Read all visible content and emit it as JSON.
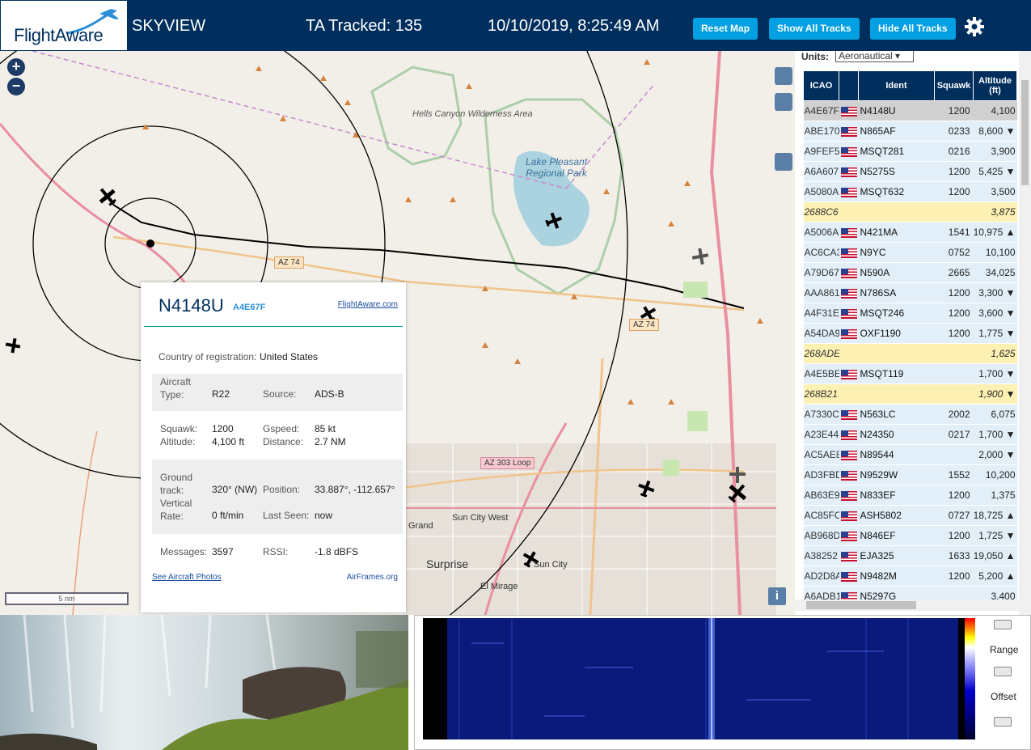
{
  "header": {
    "logo_text": "FlightAware",
    "app_name": "SKYVIEW",
    "tracked": "TA Tracked: 135",
    "datetime": "10/10/2019, 8:25:49 AM",
    "reset_label": "Reset Map",
    "show_label": "Show All Tracks",
    "hide_label": "Hide All Tracks"
  },
  "map": {
    "labels": {
      "hells_canyon": "Hells Canyon Wilderness Area",
      "lake_pleasant": "Lake Pleasant Regional Park",
      "az74_a": "AZ 74",
      "az74_b": "AZ 74",
      "az303": "AZ 303 Loop",
      "sun_city_west": "Sun City West",
      "surprise": "Surprise",
      "sun_city": "Sun City",
      "el_mirage": "El Mirage",
      "grand": "Grand"
    },
    "scale_label": "5 nm"
  },
  "popup": {
    "ident": "N4148U",
    "icao": "A4E67F",
    "link": "FlightAware.com",
    "country_label": "Country of registration:",
    "country": "United States",
    "aircraft_type_label": "Aircraft Type:",
    "aircraft_type": "R22",
    "source_label": "Source:",
    "source": "ADS-B",
    "squawk_label": "Squawk:",
    "squawk": "1200",
    "gspeed_label": "Gspeed:",
    "gspeed": "85 kt",
    "altitude_label": "Altitude:",
    "altitude": "4,100 ft",
    "distance_label": "Distance:",
    "distance": "2.7 NM",
    "track_label": "Ground track:",
    "track": "320° (NW)",
    "position_label": "Position:",
    "position": "33.887°, -112.657°",
    "vrate_label": "Vertical Rate:",
    "vrate": "0 ft/min",
    "lastseen_label": "Last Seen:",
    "lastseen": "now",
    "messages_label": "Messages:",
    "messages": "3597",
    "rssi_label": "RSSI:",
    "rssi": "-1.8 dBFS",
    "photos_link": "See Aircraft Photos",
    "airframes_link": "AirFrames.org"
  },
  "panel": {
    "units_label": "Units:",
    "units_value": "Aeronautical",
    "columns": [
      "ICAO",
      "",
      "Ident",
      "Squawk",
      "Altitude (ft)"
    ],
    "rows": [
      {
        "icao": "A4E67F",
        "flag": true,
        "ident": "N4148U",
        "squawk": "1200",
        "alt": "4,100",
        "kind": "sel"
      },
      {
        "icao": "ABE170",
        "flag": true,
        "ident": "N865AF",
        "squawk": "0233",
        "alt": "8,600 ▼",
        "kind": ""
      },
      {
        "icao": "A9FEF5",
        "flag": true,
        "ident": "MSQT281",
        "squawk": "0216",
        "alt": "3,900",
        "kind": ""
      },
      {
        "icao": "A6A607",
        "flag": true,
        "ident": "N5275S",
        "squawk": "1200",
        "alt": "5,425 ▼",
        "kind": ""
      },
      {
        "icao": "A5080A",
        "flag": true,
        "ident": "MSQT632",
        "squawk": "1200",
        "alt": "3,500",
        "kind": ""
      },
      {
        "icao": "2688C6",
        "flag": false,
        "ident": "",
        "squawk": "",
        "alt": "3,875",
        "kind": "mlat"
      },
      {
        "icao": "A5006A",
        "flag": true,
        "ident": "N421MA",
        "squawk": "1541",
        "alt": "10,975 ▲",
        "kind": ""
      },
      {
        "icao": "AC6CA3",
        "flag": true,
        "ident": "N9YC",
        "squawk": "0752",
        "alt": "10,100",
        "kind": ""
      },
      {
        "icao": "A79D67",
        "flag": true,
        "ident": "N590A",
        "squawk": "2665",
        "alt": "34,025",
        "kind": ""
      },
      {
        "icao": "AAA861",
        "flag": true,
        "ident": "N786SA",
        "squawk": "1200",
        "alt": "3,300 ▼",
        "kind": ""
      },
      {
        "icao": "A4F31E",
        "flag": true,
        "ident": "MSQT246",
        "squawk": "1200",
        "alt": "3,600 ▼",
        "kind": ""
      },
      {
        "icao": "A54DA9",
        "flag": true,
        "ident": "OXF1190",
        "squawk": "1200",
        "alt": "1,775 ▼",
        "kind": ""
      },
      {
        "icao": "268ADE",
        "flag": false,
        "ident": "",
        "squawk": "",
        "alt": "1,625",
        "kind": "mlat"
      },
      {
        "icao": "A4E5BE",
        "flag": true,
        "ident": "MSQT119",
        "squawk": "",
        "alt": "1,700 ▼",
        "kind": ""
      },
      {
        "icao": "268B21",
        "flag": false,
        "ident": "",
        "squawk": "",
        "alt": "1,900 ▼",
        "kind": "mlat"
      },
      {
        "icao": "A7330C",
        "flag": true,
        "ident": "N563LC",
        "squawk": "2002",
        "alt": "6,075",
        "kind": ""
      },
      {
        "icao": "A23E44",
        "flag": true,
        "ident": "N24350",
        "squawk": "0217",
        "alt": "1,700 ▼",
        "kind": ""
      },
      {
        "icao": "AC5AE8",
        "flag": true,
        "ident": "N89544",
        "squawk": "",
        "alt": "2,000 ▼",
        "kind": ""
      },
      {
        "icao": "AD3FBD",
        "flag": true,
        "ident": "N9529W",
        "squawk": "1552",
        "alt": "10,200",
        "kind": ""
      },
      {
        "icao": "AB63E9",
        "flag": true,
        "ident": "N833EF",
        "squawk": "1200",
        "alt": "1,375",
        "kind": ""
      },
      {
        "icao": "AC85FC",
        "flag": true,
        "ident": "ASH5802",
        "squawk": "0727",
        "alt": "18,725 ▲",
        "kind": ""
      },
      {
        "icao": "AB968D",
        "flag": true,
        "ident": "N846EF",
        "squawk": "1200",
        "alt": "1,725 ▼",
        "kind": ""
      },
      {
        "icao": "A38252",
        "flag": true,
        "ident": "EJA325",
        "squawk": "1633",
        "alt": "19,050 ▲",
        "kind": ""
      },
      {
        "icao": "AD2D8A",
        "flag": true,
        "ident": "N9482M",
        "squawk": "1200",
        "alt": "5,200 ▲",
        "kind": ""
      },
      {
        "icao": "A6ADB1",
        "flag": true,
        "ident": "N5297G",
        "squawk": "",
        "alt": "3,400",
        "kind": ""
      }
    ]
  },
  "spectrogram": {
    "range_label": "Range",
    "offset_label": "Offset"
  },
  "colors": {
    "header_bg": "#002f5d",
    "button": "#00a0e2",
    "row": "#e2eff9",
    "mlat_row": "#fdf0b3"
  }
}
